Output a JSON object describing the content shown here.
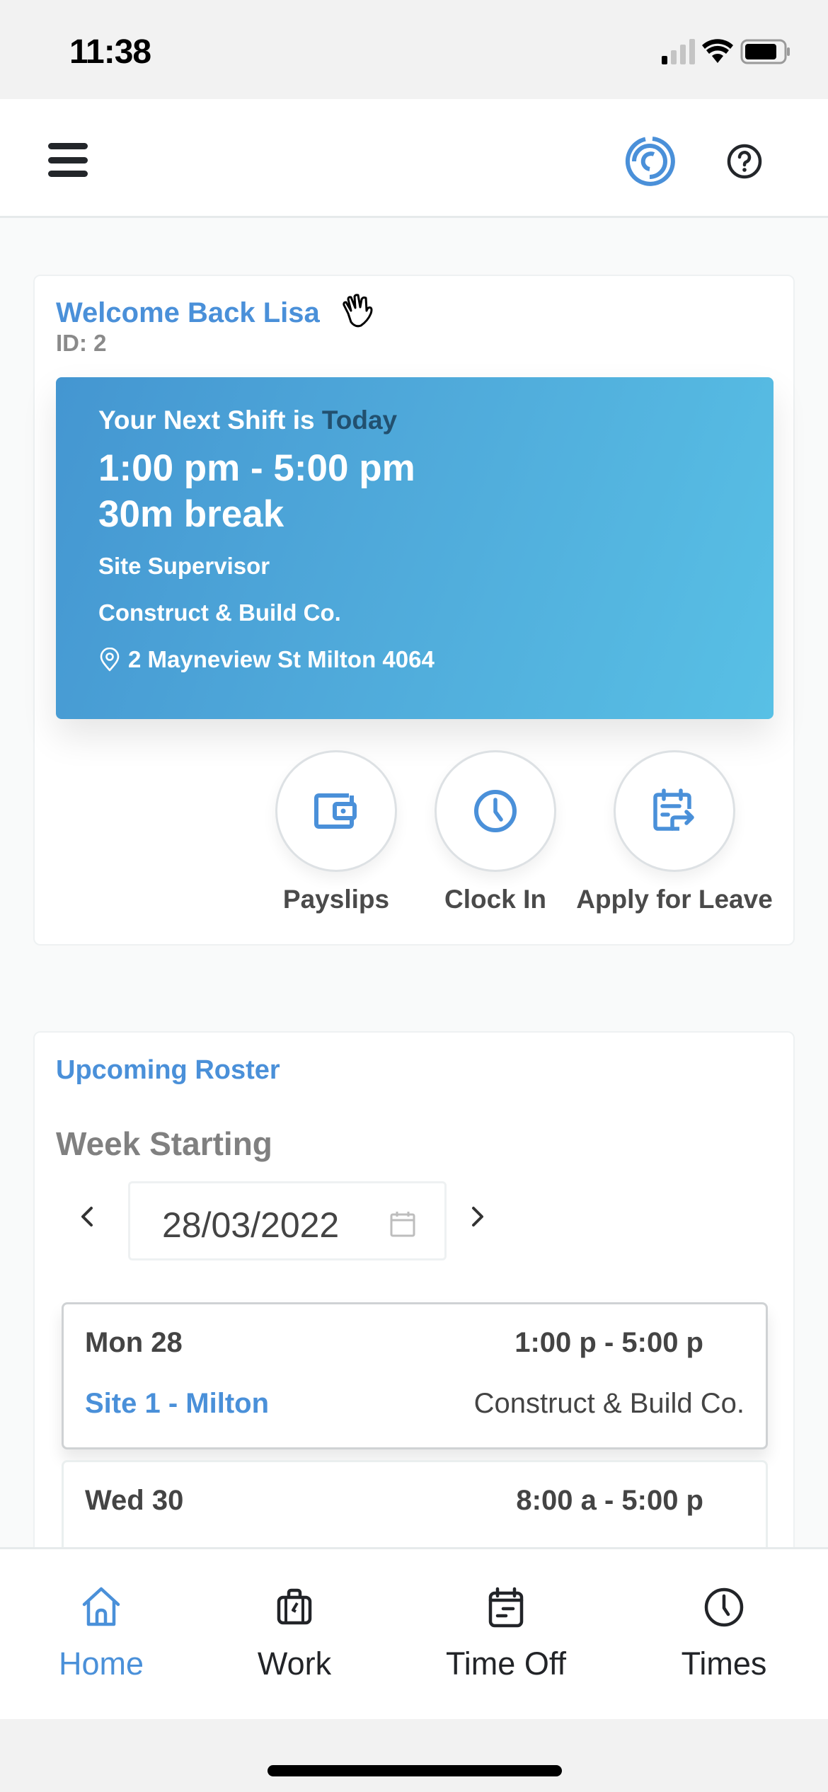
{
  "status_bar": {
    "time": "11:38",
    "signal_bars_active": 1,
    "signal_bars_total": 4,
    "icons": [
      "cellular-signal-icon",
      "wifi-icon",
      "battery-icon"
    ]
  },
  "header": {
    "menu_icon": "hamburger-menu-icon",
    "logo_icon": "maze-logo-icon",
    "help_icon": "help-circle-icon"
  },
  "welcome": {
    "title": "Welcome Back Lisa",
    "wave_icon": "waving-hand-icon",
    "id_label": "ID: 2"
  },
  "next_shift": {
    "prefix": "Your Next Shift is ",
    "day": "Today",
    "time_range": "1:00 pm - 5:00 pm",
    "break": "30m break",
    "role": "Site Supervisor",
    "company": "Construct & Build Co.",
    "address": "2 Mayneview St Milton 4064",
    "address_icon": "map-pin-icon",
    "gradient_start": "#4496d1",
    "gradient_end": "#58c0e5",
    "day_color": "#22506f"
  },
  "quick_actions": [
    {
      "label": "Payslips",
      "icon": "wallet-icon"
    },
    {
      "label": "Clock In",
      "icon": "clock-icon"
    },
    {
      "label": "Apply for Leave",
      "icon": "calendar-arrow-icon"
    }
  ],
  "roster": {
    "title": "Upcoming Roster",
    "week_label": "Week Starting",
    "week_value": "28/03/2022",
    "prev_icon": "chevron-left-icon",
    "next_icon": "chevron-right-icon",
    "calendar_icon": "calendar-icon",
    "items": [
      {
        "day": "Mon 28",
        "time": "1:00 p - 5:00 p",
        "site": "Site 1 - Milton",
        "company": "Construct & Build Co."
      },
      {
        "day": "Wed 30",
        "time": "8:00 a - 5:00 p"
      }
    ]
  },
  "bottom_nav": [
    {
      "label": "Home",
      "icon": "home-icon",
      "active": true
    },
    {
      "label": "Work",
      "icon": "briefcase-icon",
      "active": false
    },
    {
      "label": "Time Off",
      "icon": "calendar-note-icon",
      "active": false
    },
    {
      "label": "Times",
      "icon": "clock-icon",
      "active": false
    }
  ],
  "colors": {
    "accent": "#4a90d9",
    "text_dark": "#444444",
    "text_muted": "#808080",
    "background": "#f9fafa"
  }
}
